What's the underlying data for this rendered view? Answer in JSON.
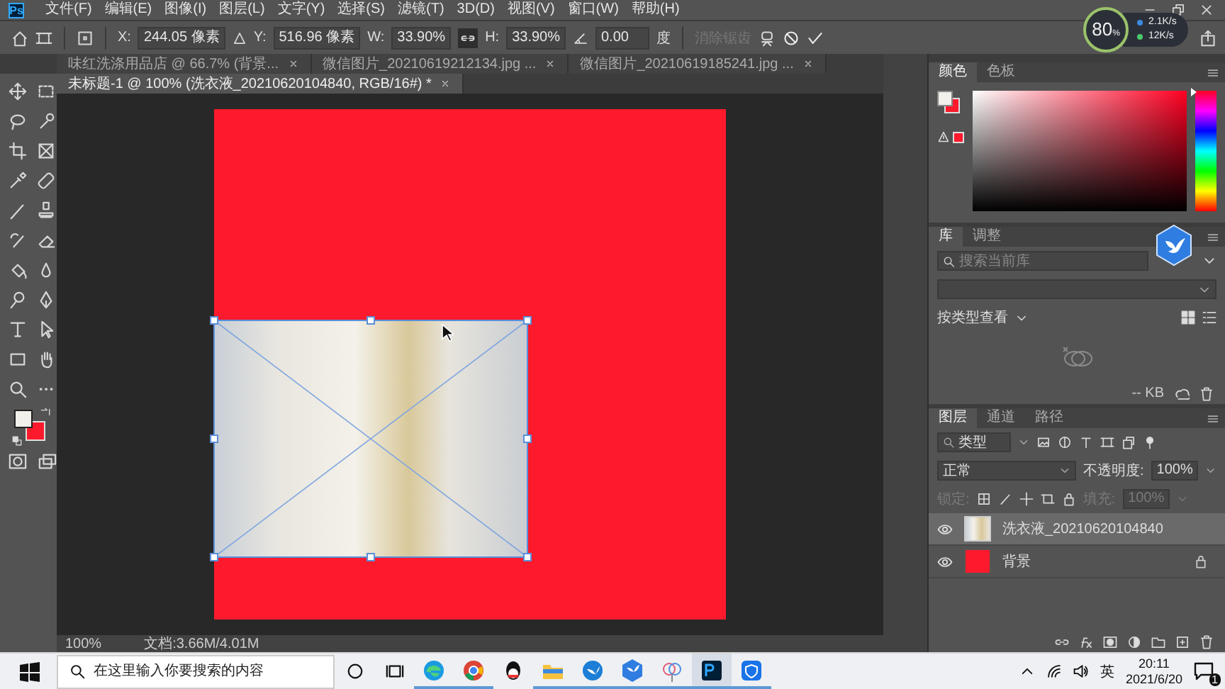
{
  "app": {
    "logo": "Ps"
  },
  "menu_bar": {
    "items": [
      "文件(F)",
      "编辑(E)",
      "图像(I)",
      "图层(L)",
      "文字(Y)",
      "选择(S)",
      "滤镜(T)",
      "3D(D)",
      "视图(V)",
      "窗口(W)",
      "帮助(H)"
    ]
  },
  "options_bar": {
    "x": {
      "label": "X:",
      "value": "244.05 像素"
    },
    "y": {
      "label": "Y:",
      "value": "516.96 像素"
    },
    "w": {
      "label": "W:",
      "value": "33.90%"
    },
    "link_proportions": true,
    "h": {
      "label": "H:",
      "value": "33.90%"
    },
    "angle": {
      "value": "0.00",
      "unit": "度"
    },
    "anti_alias": {
      "label": "消除锯齿",
      "disabled": true
    }
  },
  "document_tabs": [
    {
      "label": "味红洗涤用品店 @ 66.7% (背景...",
      "selected": false
    },
    {
      "label": "微信图片_20210619212134.jpg ...",
      "selected": false
    },
    {
      "label": "微信图片_20210619185241.jpg ...",
      "selected": false
    },
    {
      "label": "未标题-1 @ 100% (洗衣液_20210620104840, RGB/16#) *",
      "selected": true
    }
  ],
  "status_bar": {
    "zoom": "100%",
    "document_size": "文档:3.66M/4.01M"
  },
  "speed_widget": {
    "percent": "80",
    "unit": "%",
    "upload": "2.1K/s",
    "download": "12K/s"
  },
  "panels": {
    "color": {
      "tabs": [
        {
          "label": "颜色",
          "selected": true
        },
        {
          "label": "色板",
          "selected": false
        }
      ],
      "hue_slider": {
        "level": 1
      }
    },
    "library": {
      "tabs": [
        {
          "label": "库",
          "selected": true
        },
        {
          "label": "调整",
          "selected": false
        }
      ],
      "search": {
        "placeholder": "搜索当前库"
      },
      "view_label": "按类型查看",
      "storage": "-- KB"
    },
    "layers": {
      "tabs": [
        {
          "label": "图层",
          "selected": true
        },
        {
          "label": "通道",
          "selected": false
        },
        {
          "label": "路径",
          "selected": false
        }
      ],
      "filter": "类型",
      "blend_mode": "正常",
      "opacity_label": "不透明度:",
      "opacity": "100%",
      "lock_label": "锁定:",
      "fill_label": "填充:",
      "fill": "100%",
      "fill_disabled": true,
      "layers": [
        {
          "name": "洗衣液_20210620104840",
          "kind": "photo",
          "selected": true,
          "visible": true,
          "locked": false
        },
        {
          "name": "背景",
          "kind": "fill",
          "selected": false,
          "visible": true,
          "locked": true
        }
      ]
    }
  },
  "taskbar": {
    "search": {
      "placeholder": "在这里输入你要搜索的内容"
    },
    "apps": [
      {
        "kind": "edge",
        "running": true,
        "selected": false
      },
      {
        "kind": "chrome",
        "running": true,
        "selected": false
      },
      {
        "kind": "qq",
        "running": false,
        "selected": false
      },
      {
        "kind": "folder",
        "running": true,
        "selected": false
      },
      {
        "kind": "bird",
        "running": true,
        "selected": false
      },
      {
        "kind": "hexbird",
        "running": true,
        "selected": false
      },
      {
        "kind": "flower",
        "running": true,
        "selected": false
      },
      {
        "kind": "ps",
        "running": true,
        "selected": true
      },
      {
        "kind": "shield",
        "running": true,
        "selected": false
      }
    ],
    "input_method": "英",
    "time": "20:11",
    "date": "2021/6/20",
    "notifications": "1"
  }
}
